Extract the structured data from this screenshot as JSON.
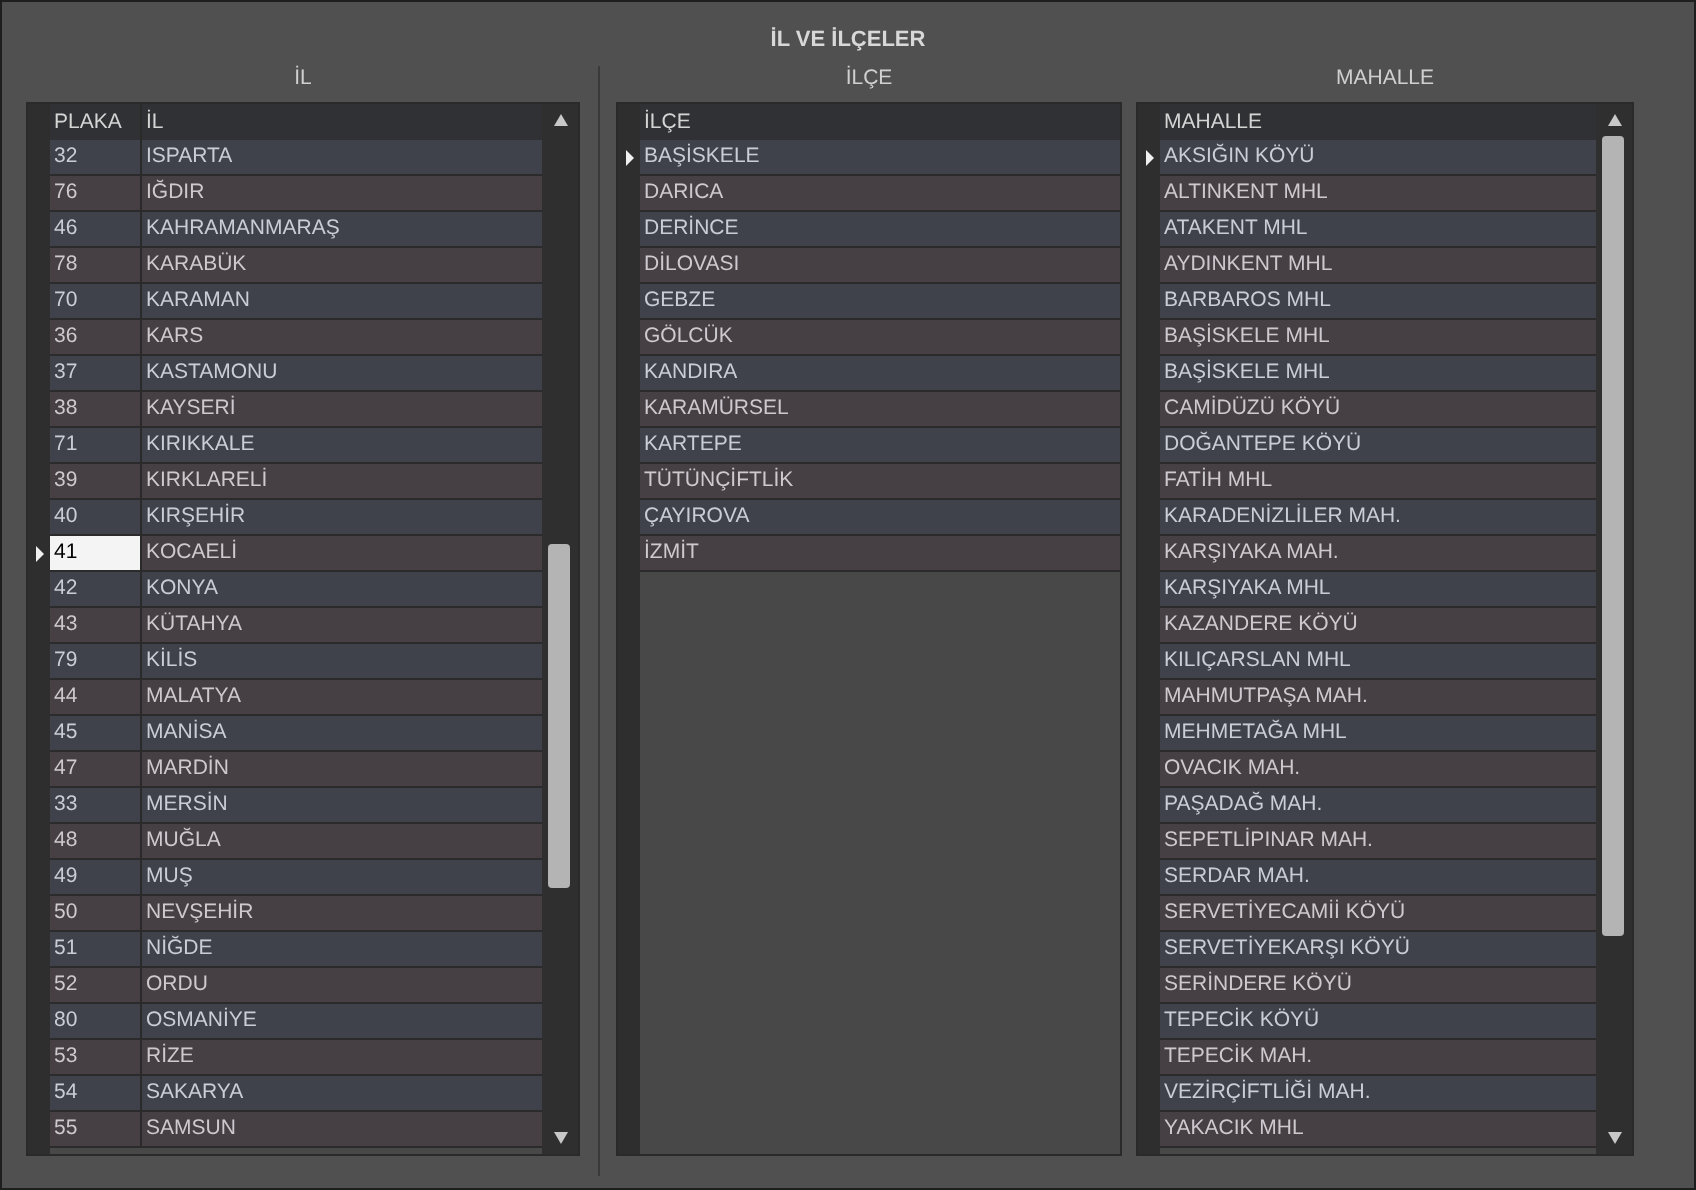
{
  "window": {
    "title": "İL VE İLÇELER"
  },
  "panels": [
    {
      "caption": "İL",
      "columns": [
        "PLAKA",
        "İL"
      ],
      "scrollbar": true,
      "rows": [
        {
          "cells": [
            "32",
            "ISPARTA"
          ],
          "current": false,
          "selected": false
        },
        {
          "cells": [
            "76",
            "IĞDIR"
          ],
          "current": false,
          "selected": false
        },
        {
          "cells": [
            "46",
            "KAHRAMANMARAŞ"
          ],
          "current": false,
          "selected": false
        },
        {
          "cells": [
            "78",
            "KARABÜK"
          ],
          "current": false,
          "selected": false
        },
        {
          "cells": [
            "70",
            "KARAMAN"
          ],
          "current": false,
          "selected": false
        },
        {
          "cells": [
            "36",
            "KARS"
          ],
          "current": false,
          "selected": false
        },
        {
          "cells": [
            "37",
            "KASTAMONU"
          ],
          "current": false,
          "selected": false
        },
        {
          "cells": [
            "38",
            "KAYSERİ"
          ],
          "current": false,
          "selected": false
        },
        {
          "cells": [
            "71",
            "KIRIKKALE"
          ],
          "current": false,
          "selected": false
        },
        {
          "cells": [
            "39",
            "KIRKLARELİ"
          ],
          "current": false,
          "selected": false
        },
        {
          "cells": [
            "40",
            "KIRŞEHİR"
          ],
          "current": false,
          "selected": false
        },
        {
          "cells": [
            "41",
            "KOCAELİ"
          ],
          "current": true,
          "selected": true
        },
        {
          "cells": [
            "42",
            "KONYA"
          ],
          "current": false,
          "selected": false
        },
        {
          "cells": [
            "43",
            "KÜTAHYA"
          ],
          "current": false,
          "selected": false
        },
        {
          "cells": [
            "79",
            "KİLİS"
          ],
          "current": false,
          "selected": false
        },
        {
          "cells": [
            "44",
            "MALATYA"
          ],
          "current": false,
          "selected": false
        },
        {
          "cells": [
            "45",
            "MANİSA"
          ],
          "current": false,
          "selected": false
        },
        {
          "cells": [
            "47",
            "MARDİN"
          ],
          "current": false,
          "selected": false
        },
        {
          "cells": [
            "33",
            "MERSİN"
          ],
          "current": false,
          "selected": false
        },
        {
          "cells": [
            "48",
            "MUĞLA"
          ],
          "current": false,
          "selected": false
        },
        {
          "cells": [
            "49",
            "MUŞ"
          ],
          "current": false,
          "selected": false
        },
        {
          "cells": [
            "50",
            "NEVŞEHİR"
          ],
          "current": false,
          "selected": false
        },
        {
          "cells": [
            "51",
            "NİĞDE"
          ],
          "current": false,
          "selected": false
        },
        {
          "cells": [
            "52",
            "ORDU"
          ],
          "current": false,
          "selected": false
        },
        {
          "cells": [
            "80",
            "OSMANİYE"
          ],
          "current": false,
          "selected": false
        },
        {
          "cells": [
            "53",
            "RİZE"
          ],
          "current": false,
          "selected": false
        },
        {
          "cells": [
            "54",
            "SAKARYA"
          ],
          "current": false,
          "selected": false
        },
        {
          "cells": [
            "55",
            "SAMSUN"
          ],
          "current": false,
          "selected": false
        }
      ]
    },
    {
      "caption": "İLÇE",
      "columns": [
        "İLÇE"
      ],
      "scrollbar": false,
      "rows": [
        {
          "cells": [
            "BAŞİSKELE"
          ],
          "current": true,
          "selected": false
        },
        {
          "cells": [
            "DARICA"
          ],
          "current": false,
          "selected": false
        },
        {
          "cells": [
            "DERİNCE"
          ],
          "current": false,
          "selected": false
        },
        {
          "cells": [
            "DİLOVASI"
          ],
          "current": false,
          "selected": false
        },
        {
          "cells": [
            "GEBZE"
          ],
          "current": false,
          "selected": false
        },
        {
          "cells": [
            "GÖLCÜK"
          ],
          "current": false,
          "selected": false
        },
        {
          "cells": [
            "KANDIRA"
          ],
          "current": false,
          "selected": false
        },
        {
          "cells": [
            "KARAMÜRSEL"
          ],
          "current": false,
          "selected": false
        },
        {
          "cells": [
            "KARTEPE"
          ],
          "current": false,
          "selected": false
        },
        {
          "cells": [
            "TÜTÜNÇİFTLİK"
          ],
          "current": false,
          "selected": false
        },
        {
          "cells": [
            "ÇAYIROVA"
          ],
          "current": false,
          "selected": false
        },
        {
          "cells": [
            "İZMİT"
          ],
          "current": false,
          "selected": false
        }
      ]
    },
    {
      "caption": "MAHALLE",
      "columns": [
        "MAHALLE"
      ],
      "scrollbar": true,
      "rows": [
        {
          "cells": [
            "AKSIĞIN KÖYÜ"
          ],
          "current": true,
          "selected": false
        },
        {
          "cells": [
            "ALTINKENT MHL"
          ],
          "current": false,
          "selected": false
        },
        {
          "cells": [
            "ATAKENT MHL"
          ],
          "current": false,
          "selected": false
        },
        {
          "cells": [
            "AYDINKENT MHL"
          ],
          "current": false,
          "selected": false
        },
        {
          "cells": [
            "BARBAROS MHL"
          ],
          "current": false,
          "selected": false
        },
        {
          "cells": [
            "BAŞİSKELE MHL"
          ],
          "current": false,
          "selected": false
        },
        {
          "cells": [
            "BAŞİSKELE MHL"
          ],
          "current": false,
          "selected": false
        },
        {
          "cells": [
            "CAMİDÜZÜ KÖYÜ"
          ],
          "current": false,
          "selected": false
        },
        {
          "cells": [
            "DOĞANTEPE KÖYÜ"
          ],
          "current": false,
          "selected": false
        },
        {
          "cells": [
            "FATİH MHL"
          ],
          "current": false,
          "selected": false
        },
        {
          "cells": [
            "KARADENİZLİLER MAH."
          ],
          "current": false,
          "selected": false
        },
        {
          "cells": [
            "KARŞIYAKA MAH."
          ],
          "current": false,
          "selected": false
        },
        {
          "cells": [
            "KARŞIYAKA MHL"
          ],
          "current": false,
          "selected": false
        },
        {
          "cells": [
            "KAZANDERE KÖYÜ"
          ],
          "current": false,
          "selected": false
        },
        {
          "cells": [
            "KILIÇARSLAN MHL"
          ],
          "current": false,
          "selected": false
        },
        {
          "cells": [
            "MAHMUTPAŞA MAH."
          ],
          "current": false,
          "selected": false
        },
        {
          "cells": [
            "MEHMETAĞA MHL"
          ],
          "current": false,
          "selected": false
        },
        {
          "cells": [
            "OVACIK MAH."
          ],
          "current": false,
          "selected": false
        },
        {
          "cells": [
            "PAŞADAĞ MAH."
          ],
          "current": false,
          "selected": false
        },
        {
          "cells": [
            "SEPETLİPINAR MAH."
          ],
          "current": false,
          "selected": false
        },
        {
          "cells": [
            "SERDAR MAH."
          ],
          "current": false,
          "selected": false
        },
        {
          "cells": [
            "SERVETİYECAMİİ KÖYÜ"
          ],
          "current": false,
          "selected": false
        },
        {
          "cells": [
            "SERVETİYEKARŞI KÖYÜ"
          ],
          "current": false,
          "selected": false
        },
        {
          "cells": [
            "SERİNDERE KÖYÜ"
          ],
          "current": false,
          "selected": false
        },
        {
          "cells": [
            "TEPECİK KÖYÜ"
          ],
          "current": false,
          "selected": false
        },
        {
          "cells": [
            "TEPECİK MAH."
          ],
          "current": false,
          "selected": false
        },
        {
          "cells": [
            "VEZİRÇİFTLİĞİ MAH."
          ],
          "current": false,
          "selected": false
        },
        {
          "cells": [
            "YAKACIK MHL"
          ],
          "current": false,
          "selected": false
        }
      ]
    }
  ]
}
